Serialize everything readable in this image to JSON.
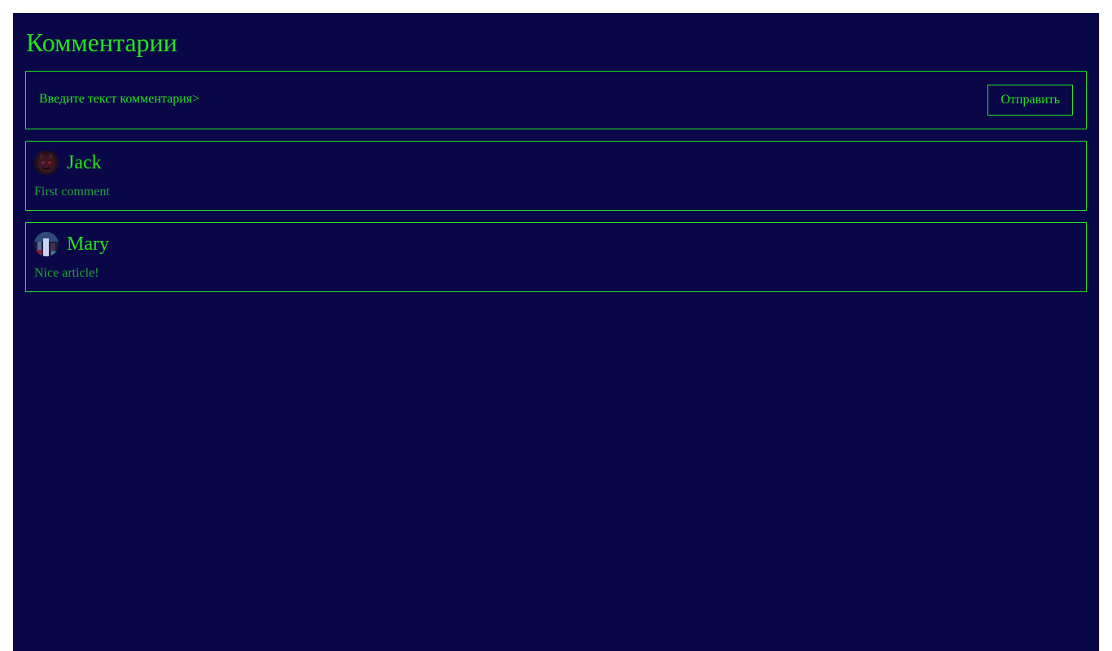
{
  "header": {
    "title": "Комментарии"
  },
  "comment_form": {
    "placeholder": "Введите текст комментария>",
    "submit_label": "Отправить"
  },
  "comments": [
    {
      "author": "Jack",
      "text": "First comment",
      "avatar_icon": "dark-cat-avatar-icon"
    },
    {
      "author": "Mary",
      "text": "Nice article!",
      "avatar_icon": "night-city-avatar-icon"
    }
  ],
  "colors": {
    "background": "#0a0748",
    "accent": "#22e51a",
    "muted_text": "#1fa33a",
    "page_margin": "#ffffff"
  }
}
